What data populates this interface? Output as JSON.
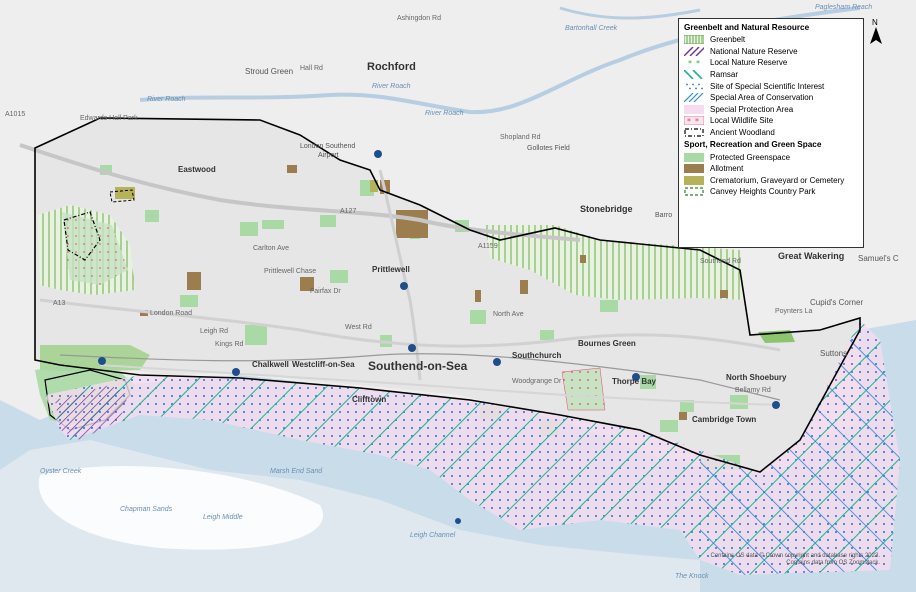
{
  "legend": {
    "section_natural": "Greenbelt and Natural Resource",
    "natural_items": [
      {
        "label": "Greenbelt",
        "icon": "greenbelt-swatch",
        "color": "#7ab85a"
      },
      {
        "label": "National Nature Reserve",
        "icon": "nnr-swatch",
        "color": "#7030a0"
      },
      {
        "label": "Local Nature Reserve",
        "icon": "lnr-swatch",
        "color": "#3aa845"
      },
      {
        "label": "Ramsar",
        "icon": "ramsar-swatch",
        "color": "#1ab394"
      },
      {
        "label": "Site of Special Scientific Interest",
        "icon": "sssi-swatch",
        "color": "#2f6fd1"
      },
      {
        "label": "Special Area of Conservation",
        "icon": "sac-swatch",
        "color": "#2f8fe0"
      },
      {
        "label": "Special Protection Area",
        "icon": "spa-swatch",
        "color": "#f6dcef"
      },
      {
        "label": "Local Wildlife Site",
        "icon": "lws-swatch",
        "color": "#e0457b"
      },
      {
        "label": "Ancient Woodland",
        "icon": "ancient-woodland-swatch",
        "color": "#000000"
      }
    ],
    "section_green": "Sport, Recreation and Green Space",
    "green_items": [
      {
        "label": "Protected Greenspace",
        "icon": "greenspace-swatch",
        "color": "#a9d9a4"
      },
      {
        "label": "Allotment",
        "icon": "allotment-swatch",
        "color": "#9b7d4e"
      },
      {
        "label": "Crematorium, Graveyard or Cemetery",
        "icon": "cemetery-swatch",
        "color": "#b5b25a"
      },
      {
        "label": "Canvey Heights Country Park",
        "icon": "country-park-swatch",
        "color": "#2f7d2f"
      }
    ]
  },
  "places": {
    "rochford": "Rochford",
    "stroud_green": "Stroud Green",
    "eastwood": "Eastwood",
    "london_southend_airport": "London Southend Airport",
    "stonebridge": "Stonebridge",
    "prittlewell": "Prittlewell",
    "great_wakering": "Great Wakering",
    "samuels_corner": "Samuel's C",
    "cupids_corner": "Cupid's Corner",
    "suttons": "Suttons",
    "chalkwell": "Chalkwell",
    "westcliff": "Westcliff-on-Sea",
    "southend": "Southend-on-Sea",
    "southchurch": "Southchurch",
    "bournes_green": "Bournes Green",
    "thorpe_bay": "Thorpe Bay",
    "north_shoebury": "North Shoebury",
    "cambridge_town": "Cambridge Town",
    "clifftown": "Clifftown",
    "gollotes_field": "Gollotes Field",
    "barrow": "Barro"
  },
  "water": {
    "river_roach_1": "River Roach",
    "river_roach_2": "River Roach",
    "river_roach_3": "River Roach",
    "paglesham_reach": "Paglesham Reach",
    "bartonhall_creek": "Bartonhall Creek",
    "marsh_end_sand": "Marsh End Sand",
    "oyster_creek": "Oyster Creek",
    "chapman_sands": "Chapman Sands",
    "leigh_middle": "Leigh Middle",
    "leigh_channel": "Leigh Channel",
    "the_knock": "The Knock"
  },
  "roads": {
    "edwards_hall_park": "Edwards Hall Park",
    "london_road": "London Road",
    "carlton_ave": "Carlton Ave",
    "prittlewell_chase": "Prittlewell Chase",
    "fairfax_dr": "Fairfax Dr",
    "north_ave": "North Ave",
    "woodgrange_dr": "Woodgrange Dr",
    "southend_rd": "Southend Rd",
    "poynters_la": "Poynters La",
    "shopland_rd": "Shopland Rd",
    "ashingdon_rd": "Ashingdon Rd",
    "hall_rd": "Hall Rd",
    "bellamy_rd": "Bellamy Rd",
    "west_rd": "West Rd",
    "a13": "A13",
    "a127": "A127",
    "kings_rd": "Kings Rd",
    "leigh_rd": "Leigh Rd",
    "a1159": "A1159",
    "a1015": "A1015"
  },
  "north_label": "N",
  "attribution": "Contains OS data © Crown copyright and database rights 2023. Contains data from OS Zoomstack."
}
